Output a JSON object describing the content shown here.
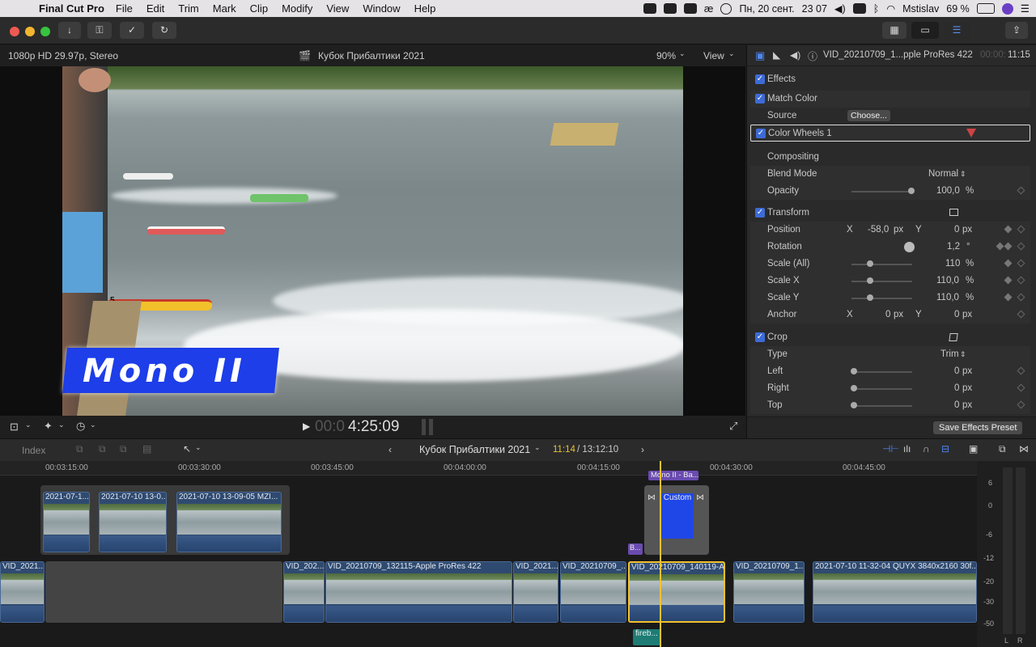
{
  "menubar": {
    "app": "Final Cut Pro",
    "items": [
      "File",
      "Edit",
      "Trim",
      "Mark",
      "Clip",
      "Modify",
      "View",
      "Window",
      "Help"
    ],
    "date": "Пн, 20 сент.",
    "time": "23 07",
    "user": "Mstislav",
    "battery": "69 %"
  },
  "viewer": {
    "format": "1080p HD 29.97p, Stereo",
    "project": "Кубок Прибалтики 2021",
    "zoom": "90%",
    "view": "View",
    "timecode_dim": "00:0",
    "timecode": "4:25:09",
    "title_text": "Mono II",
    "boat_number": "5"
  },
  "inspector": {
    "clip_name": "VID_20210709_1...pple ProRes 422",
    "duration_dim": "00:00:",
    "duration": "11:15",
    "effects": "Effects",
    "match_color": "Match Color",
    "source": "Source",
    "choose": "Choose...",
    "color_wheels": "Color Wheels 1",
    "compositing": "Compositing",
    "blend_mode": "Blend Mode",
    "blend_value": "Normal",
    "opacity": "Opacity",
    "opacity_value": "100,0",
    "pct": "%",
    "transform": "Transform",
    "position": "Position",
    "x": "X",
    "y": "Y",
    "pos_x": "-58,0",
    "pos_y": "0",
    "px": "px",
    "rotation": "Rotation",
    "rot_value": "1,2",
    "deg": "°",
    "scale_all": "Scale (All)",
    "scale_all_v": "110",
    "scale_x": "Scale X",
    "scale_x_v": "110,0",
    "scale_y": "Scale Y",
    "scale_y_v": "110,0",
    "anchor": "Anchor",
    "anchor_x": "0",
    "anchor_y": "0",
    "crop": "Crop",
    "type": "Type",
    "type_value": "Trim",
    "left": "Left",
    "left_v": "0",
    "right": "Right",
    "right_v": "0",
    "top": "Top",
    "top_v": "0",
    "save_preset": "Save Effects Preset"
  },
  "timeline": {
    "index": "Index",
    "project": "Кубок Прибалтики 2021",
    "position": "11:14",
    "total": "/ 13:12:10",
    "ruler": [
      "00:03:15:00",
      "00:03:30:00",
      "00:03:45:00",
      "00:04:00:00",
      "00:04:15:00",
      "00:04:30:00",
      "00:04:45:00"
    ],
    "upper_clips": [
      "2021-07-1...",
      "2021-07-10 13-0...",
      "2021-07-10 13-09-05 MZI..."
    ],
    "title_clip": "Mono II - Ba...",
    "custom": "Custom",
    "b_marker": "B...",
    "main_clips": [
      "VID_2021...",
      "VID_202...",
      "VID_20210709_132115-Apple ProRes 422",
      "VID_2021...",
      "VID_20210709_...",
      "VID_20210709_140119-A...",
      "VID_20210709_1...",
      "2021-07-10 11-32-04 QUYX 3840x2160 30f..."
    ],
    "audio_clip": "fireb..."
  },
  "meters": {
    "scale": [
      "6",
      "0",
      "-6",
      "-12",
      "-20",
      "-30",
      "-50"
    ],
    "l": "L",
    "r": "R"
  }
}
